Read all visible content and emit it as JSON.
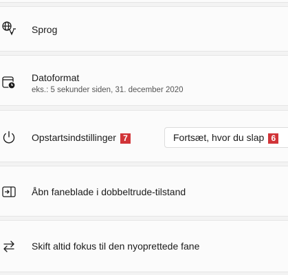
{
  "rows": {
    "language": {
      "label": "Sprog"
    },
    "date_format": {
      "label": "Datoformat",
      "example": "eks.: 5 sekunder siden, 31. december 2020"
    },
    "startup": {
      "label": "Opstartsindstillinger",
      "badge": "7",
      "dropdown_value": "Fortsæt, hvor du slap",
      "dropdown_badge": "6"
    },
    "open_tabs": {
      "label": "Åbn faneblade i dobbeltrude-tilstand"
    },
    "focus": {
      "label": "Skift altid fokus til den nyoprettede fane"
    }
  },
  "colors": {
    "badge": "#d13438",
    "background": "#f3f3f3",
    "card": "#fbfbfb"
  }
}
